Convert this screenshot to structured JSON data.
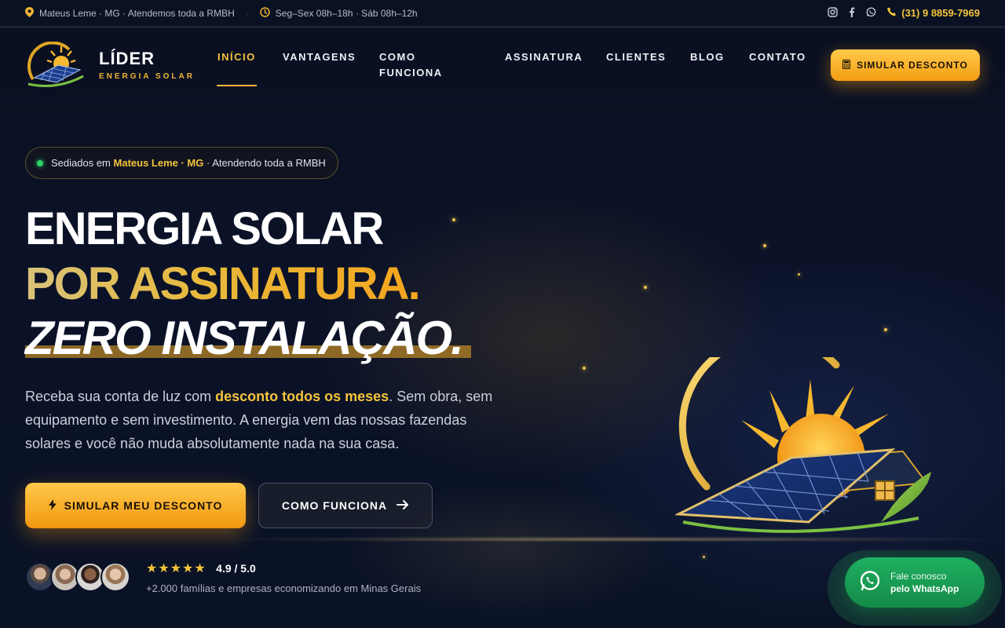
{
  "topbar": {
    "location": "Mateus Leme · MG · Atendemos toda a RMBH",
    "hours": "Seg–Sex 08h–18h · Sáb 08h–12h",
    "phone": "(31) 9 8859-7969"
  },
  "brand": {
    "name": "LÍDER",
    "tagline": "ENERGIA SOLAR"
  },
  "nav": {
    "items": [
      "INÍCIO",
      "VANTAGENS",
      "COMO FUNCIONA",
      "ASSINATURA",
      "CLIENTES",
      "BLOG",
      "CONTATO"
    ],
    "active": "INÍCIO",
    "cta": "SIMULAR DESCONTO"
  },
  "hero": {
    "badge_prefix": "Sediados em",
    "badge_highlight": "Mateus Leme · MG",
    "badge_suffix": "· Atendendo toda a RMBH",
    "title_line1": "ENERGIA SOLAR",
    "title_line2": "POR ASSINATURA.",
    "title_line3": "ZERO INSTALAÇÃO.",
    "lead_before": "Receba sua conta de luz com ",
    "lead_highlight": "desconto todos os meses",
    "lead_after": ". Sem obra, sem equipamento e sem investimento. A energia vem das nossas fazendas solares e você não muda absolutamente nada na sua casa.",
    "primary_cta": "SIMULAR MEU DESCONTO",
    "secondary_cta": "COMO FUNCIONA"
  },
  "social_proof": {
    "rating": "4.9 / 5.0",
    "stars": 5,
    "caption": "+2.000 famílias e empresas economizando em Minas Gerais"
  },
  "whatsapp": {
    "line1": "Fale conosco",
    "line2": "pelo WhatsApp"
  },
  "colors": {
    "accent": "#f4c43b",
    "cta_orange": "#f59d12",
    "whatsapp_green": "#1fb060",
    "background": "#0a1226"
  }
}
